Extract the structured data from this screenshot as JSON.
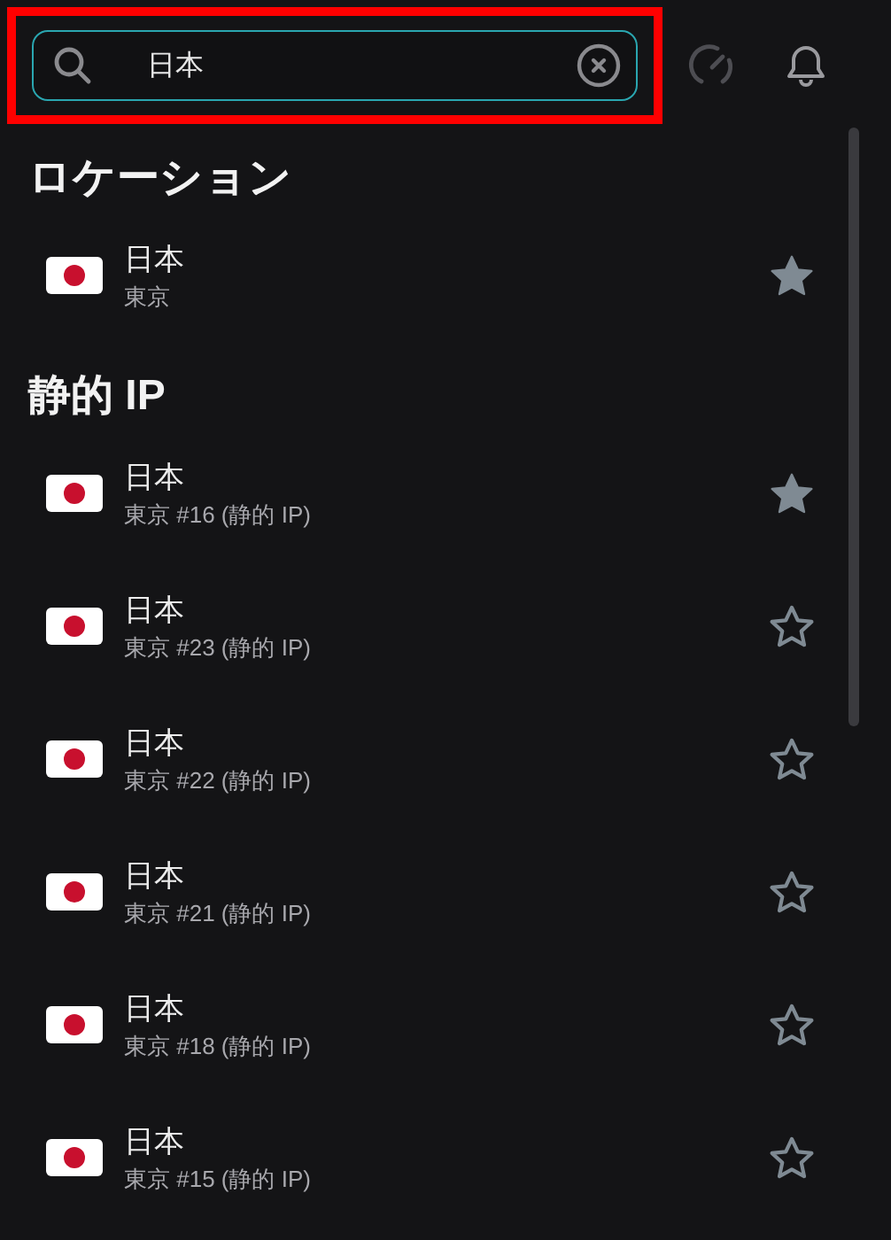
{
  "search": {
    "value": "日本",
    "highlighted": true
  },
  "sections": [
    {
      "title": "ロケーション",
      "items": [
        {
          "country": "日本",
          "city": "東京",
          "favorite": true
        }
      ]
    },
    {
      "title": "静的 IP",
      "items": [
        {
          "country": "日本",
          "city": "東京 #16 (静的 IP)",
          "favorite": true
        },
        {
          "country": "日本",
          "city": "東京 #23 (静的 IP)",
          "favorite": false
        },
        {
          "country": "日本",
          "city": "東京 #22 (静的 IP)",
          "favorite": false
        },
        {
          "country": "日本",
          "city": "東京 #21 (静的 IP)",
          "favorite": false
        },
        {
          "country": "日本",
          "city": "東京 #18 (静的 IP)",
          "favorite": false
        },
        {
          "country": "日本",
          "city": "東京 #15 (静的 IP)",
          "favorite": false
        }
      ]
    }
  ]
}
